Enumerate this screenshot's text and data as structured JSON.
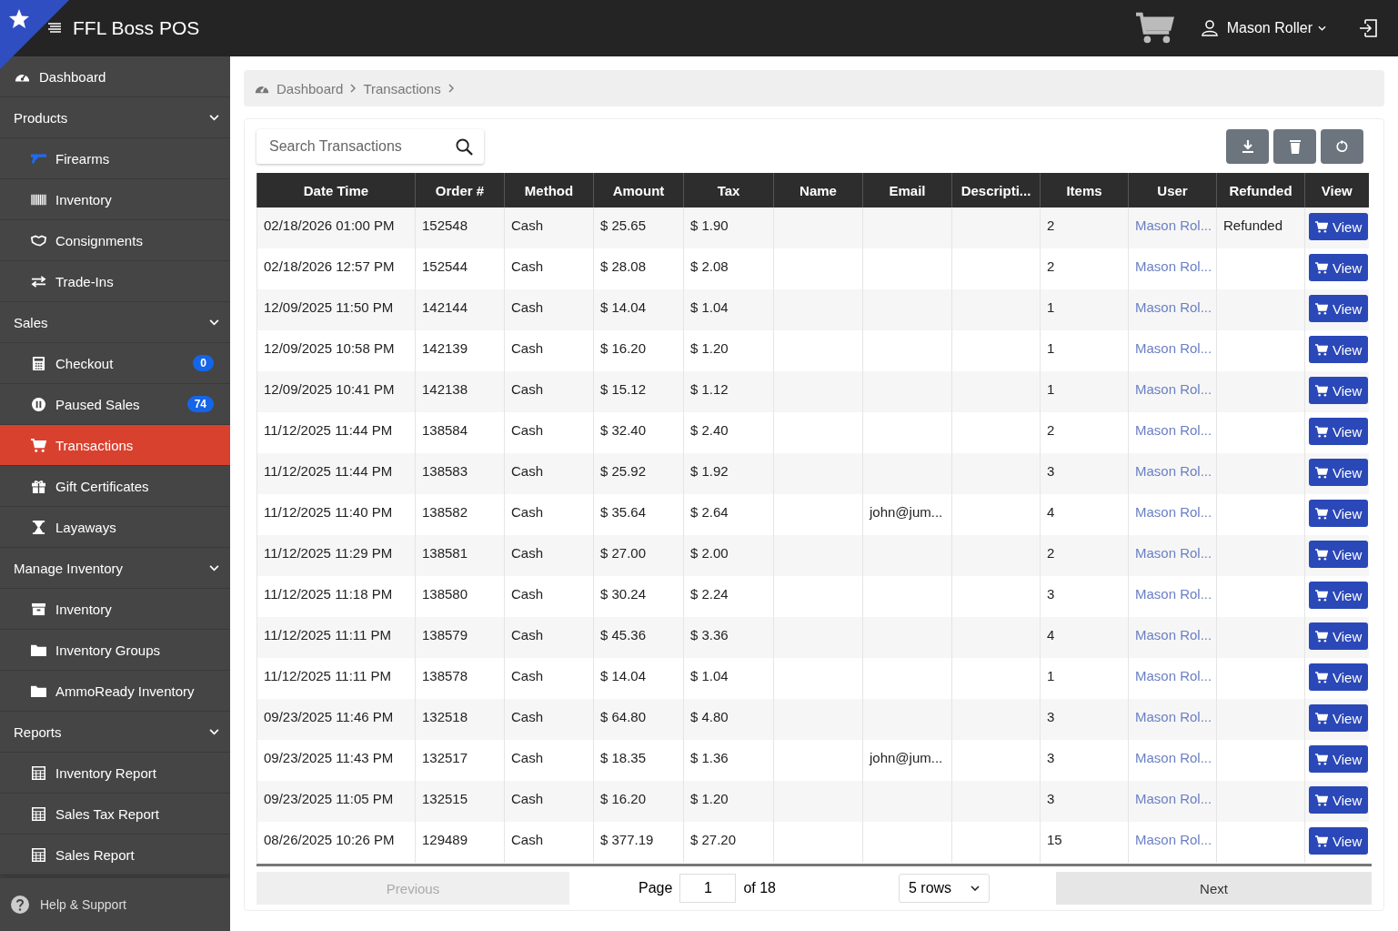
{
  "app": {
    "title": "FFL Boss POS",
    "user": "Mason Roller"
  },
  "sidebar": {
    "items": [
      {
        "kind": "link",
        "label": "Dashboard",
        "selected": false
      },
      {
        "kind": "section",
        "label": "Products",
        "expanded": true,
        "children": [
          {
            "label": "Firearms",
            "selected": false
          },
          {
            "label": "Inventory",
            "selected": false
          },
          {
            "label": "Consignments",
            "selected": false
          },
          {
            "label": "Trade-Ins",
            "selected": false
          }
        ]
      },
      {
        "kind": "section",
        "label": "Sales",
        "expanded": true,
        "children": [
          {
            "label": "Checkout",
            "badge": "0",
            "selected": false
          },
          {
            "label": "Paused Sales",
            "badge": "74",
            "selected": false
          },
          {
            "label": "Transactions",
            "selected": true
          },
          {
            "label": "Gift Certificates",
            "selected": false
          },
          {
            "label": "Layaways",
            "selected": false
          }
        ]
      },
      {
        "kind": "section",
        "label": "Manage Inventory",
        "expanded": true,
        "children": [
          {
            "label": "Inventory",
            "selected": false
          },
          {
            "label": "Inventory Groups",
            "selected": false
          },
          {
            "label": "AmmoReady Inventory",
            "selected": false
          }
        ]
      },
      {
        "kind": "section",
        "label": "Reports",
        "expanded": true,
        "children": [
          {
            "label": "Inventory Report",
            "selected": false
          },
          {
            "label": "Sales Tax Report",
            "selected": false
          },
          {
            "label": "Sales Report",
            "selected": false
          }
        ]
      }
    ],
    "footer": "Help & Support"
  },
  "breadcrumb": [
    "Dashboard",
    "Transactions"
  ],
  "search": {
    "placeholder": "Search Transactions"
  },
  "table": {
    "columns": [
      "Date Time",
      "Order #",
      "Method",
      "Amount",
      "Tax",
      "Name",
      "Email",
      "Descripti...",
      "Items",
      "User",
      "Refunded",
      "View"
    ],
    "rows": [
      {
        "date": "02/18/2026 01:00 PM",
        "order": "152548",
        "method": "Cash",
        "amount": "$ 25.65",
        "tax": "$ 1.90",
        "items": "2",
        "user": "Mason Rol...",
        "refunded": "Refunded",
        "view": "View"
      },
      {
        "date": "02/18/2026 12:57 PM",
        "order": "152544",
        "method": "Cash",
        "amount": "$ 28.08",
        "tax": "$ 2.08",
        "items": "2",
        "user": "Mason Rol...",
        "view": "View"
      },
      {
        "date": "12/09/2025 11:50 PM",
        "order": "142144",
        "method": "Cash",
        "amount": "$ 14.04",
        "tax": "$ 1.04",
        "items": "1",
        "user": "Mason Rol...",
        "view": "View"
      },
      {
        "date": "12/09/2025 10:58 PM",
        "order": "142139",
        "method": "Cash",
        "amount": "$ 16.20",
        "tax": "$ 1.20",
        "items": "1",
        "user": "Mason Rol...",
        "view": "View"
      },
      {
        "date": "12/09/2025 10:41 PM",
        "order": "142138",
        "method": "Cash",
        "amount": "$ 15.12",
        "tax": "$ 1.12",
        "items": "1",
        "user": "Mason Rol...",
        "view": "View"
      },
      {
        "date": "11/12/2025 11:44 PM",
        "order": "138584",
        "method": "Cash",
        "amount": "$ 32.40",
        "tax": "$ 2.40",
        "items": "2",
        "user": "Mason Rol...",
        "view": "View"
      },
      {
        "date": "11/12/2025 11:44 PM",
        "order": "138583",
        "method": "Cash",
        "amount": "$ 25.92",
        "tax": "$ 1.92",
        "items": "3",
        "user": "Mason Rol...",
        "view": "View"
      },
      {
        "date": "11/12/2025 11:40 PM",
        "order": "138582",
        "method": "Cash",
        "amount": "$ 35.64",
        "tax": "$ 2.64",
        "email": "john@jum...",
        "items": "4",
        "user": "Mason Rol...",
        "view": "View"
      },
      {
        "date": "11/12/2025 11:29 PM",
        "order": "138581",
        "method": "Cash",
        "amount": "$ 27.00",
        "tax": "$ 2.00",
        "items": "2",
        "user": "Mason Rol...",
        "view": "View"
      },
      {
        "date": "11/12/2025 11:18 PM",
        "order": "138580",
        "method": "Cash",
        "amount": "$ 30.24",
        "tax": "$ 2.24",
        "items": "3",
        "user": "Mason Rol...",
        "view": "View"
      },
      {
        "date": "11/12/2025 11:11 PM",
        "order": "138579",
        "method": "Cash",
        "amount": "$ 45.36",
        "tax": "$ 3.36",
        "items": "4",
        "user": "Mason Rol...",
        "view": "View"
      },
      {
        "date": "11/12/2025 11:11 PM",
        "order": "138578",
        "method": "Cash",
        "amount": "$ 14.04",
        "tax": "$ 1.04",
        "items": "1",
        "user": "Mason Rol...",
        "view": "View"
      },
      {
        "date": "09/23/2025 11:46 PM",
        "order": "132518",
        "method": "Cash",
        "amount": "$ 64.80",
        "tax": "$ 4.80",
        "items": "3",
        "user": "Mason Rol...",
        "view": "View"
      },
      {
        "date": "09/23/2025 11:43 PM",
        "order": "132517",
        "method": "Cash",
        "amount": "$ 18.35",
        "tax": "$ 1.36",
        "email": "john@jum...",
        "items": "3",
        "user": "Mason Rol...",
        "view": "View"
      },
      {
        "date": "09/23/2025 11:05 PM",
        "order": "132515",
        "method": "Cash",
        "amount": "$ 16.20",
        "tax": "$ 1.20",
        "items": "3",
        "user": "Mason Rol...",
        "view": "View"
      },
      {
        "date": "08/26/2025 10:26 PM",
        "order": "129489",
        "method": "Cash",
        "amount": "$ 377.19",
        "tax": "$ 27.20",
        "items": "15",
        "user": "Mason Rol...",
        "view": "View"
      }
    ]
  },
  "pagination": {
    "previous": "Previous",
    "previous_disabled": true,
    "page_label": "Page",
    "page": "1",
    "of": "of 18",
    "rows": "5 rows",
    "next": "Next"
  }
}
